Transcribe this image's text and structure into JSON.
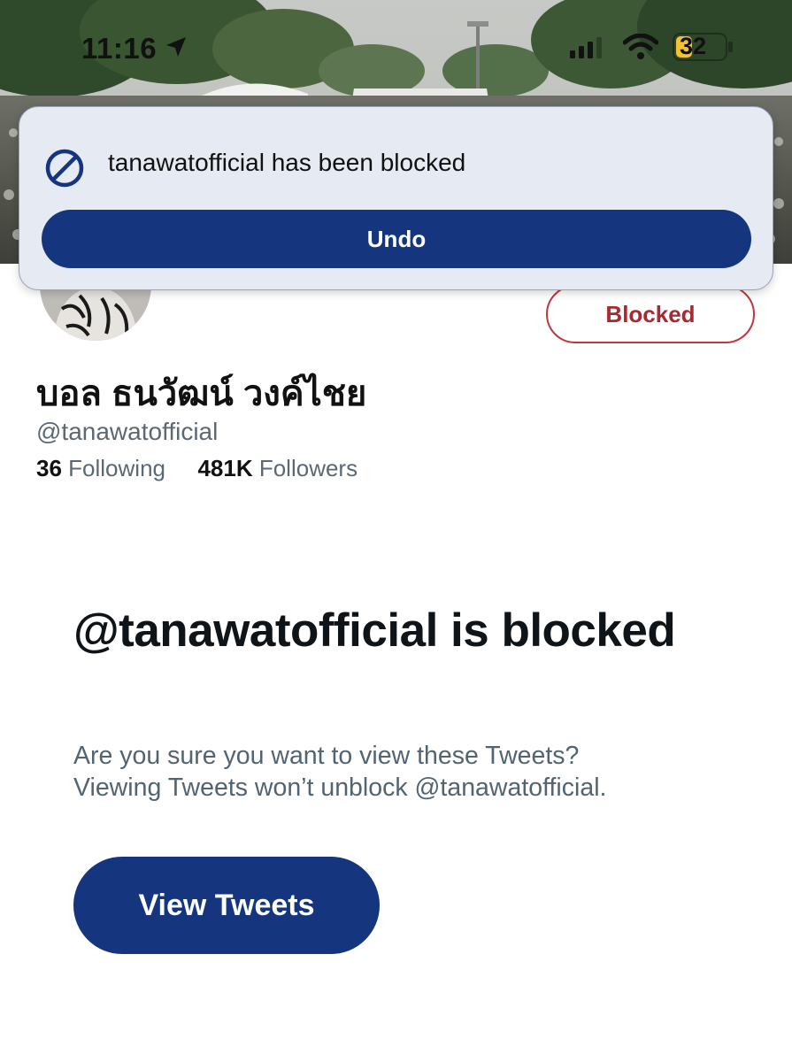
{
  "status_bar": {
    "time": "11:16",
    "battery_level": "32",
    "icons": [
      "location-arrow-icon",
      "signal-icon",
      "wifi-icon",
      "battery-icon"
    ]
  },
  "toast": {
    "icon": "block-icon",
    "message": "tanawatofficial has been blocked",
    "undo_label": "Undo"
  },
  "profile": {
    "display_name": "บอล ธนวัฒน์ วงค์ไชย",
    "handle": "@tanawatofficial",
    "following_count": "36",
    "following_label": "Following",
    "followers_count": "481K",
    "followers_label": "Followers",
    "blocked_button_label": "Blocked"
  },
  "blocked_panel": {
    "heading": "@tanawatofficial is blocked",
    "description_line1": "Are you sure you want to view these Tweets?",
    "description_line2": "Viewing Tweets won’t unblock @tanawatofficial.",
    "view_button_label": "View Tweets"
  },
  "colors": {
    "primary_button": "#15367f",
    "blocked_red": "#a8292f",
    "toast_background": "#e6eaf2",
    "secondary_text": "#536471"
  }
}
